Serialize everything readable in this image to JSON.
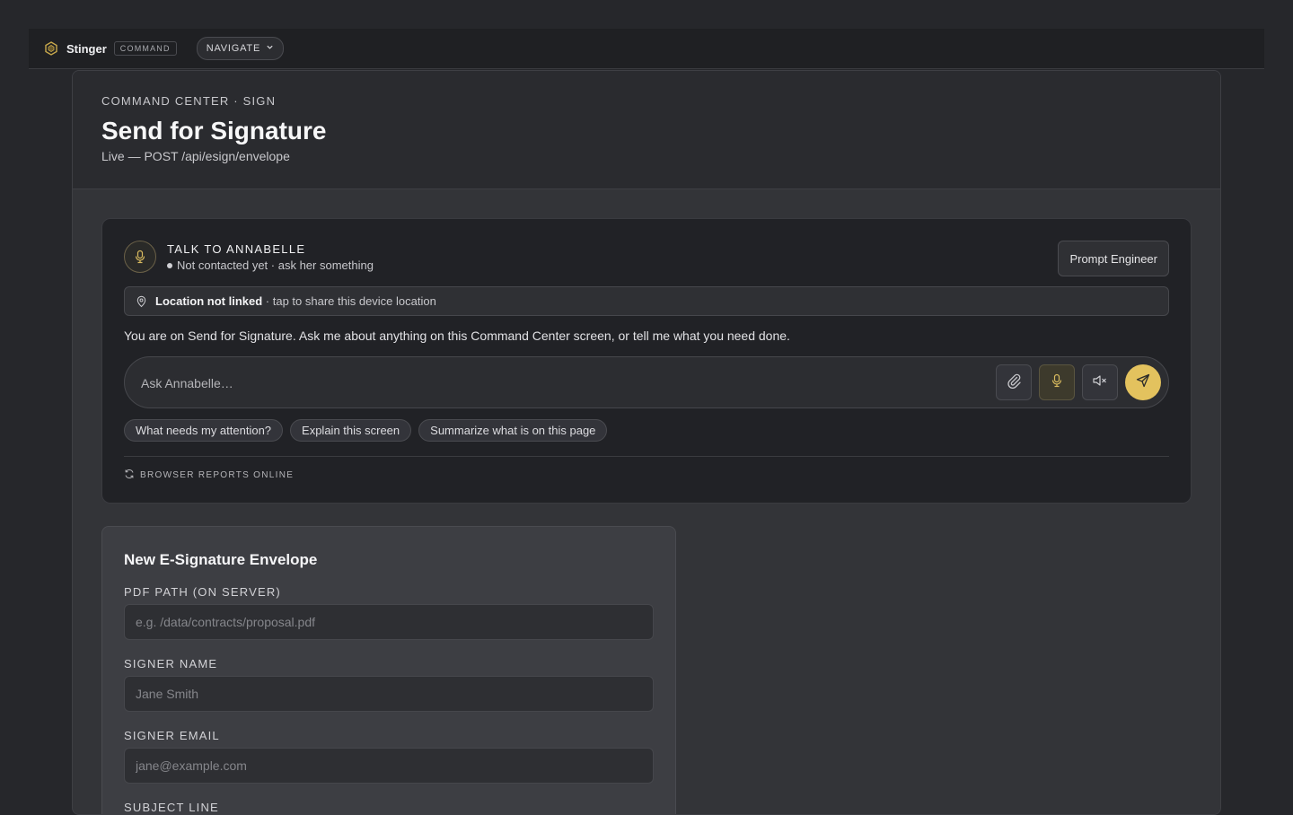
{
  "topbar": {
    "brand_name": "Stinger",
    "brand_tag": "COMMAND",
    "nav_label": "NAVIGATE"
  },
  "header": {
    "eyebrow": "COMMAND CENTER · SIGN",
    "title": "Send for Signature",
    "subtitle": "Live — POST /api/esign/envelope"
  },
  "assistant": {
    "title": "TALK TO ANNABELLE",
    "status": "Not contacted yet · ask her something",
    "prompt_engineer_label": "Prompt Engineer",
    "location_bold": "Location not linked",
    "location_rest": " · tap to share this device location",
    "message": "You are on Send for Signature. Ask me about anything on this Command Center screen, or tell me what you need done.",
    "input_placeholder": "Ask Annabelle…",
    "input_value": "",
    "chips": [
      "What needs my attention?",
      "Explain this screen",
      "Summarize what is on this page"
    ],
    "online_label": "BROWSER REPORTS ONLINE",
    "accent_color": "#e3c25e"
  },
  "form": {
    "title": "New E-Signature Envelope",
    "fields": [
      {
        "label": "PDF PATH (ON SERVER)",
        "placeholder": "e.g. /data/contracts/proposal.pdf",
        "value": ""
      },
      {
        "label": "SIGNER NAME",
        "placeholder": "Jane Smith",
        "value": ""
      },
      {
        "label": "SIGNER EMAIL",
        "placeholder": "jane@example.com",
        "value": ""
      },
      {
        "label": "SUBJECT LINE",
        "placeholder": "",
        "value": ""
      }
    ]
  }
}
